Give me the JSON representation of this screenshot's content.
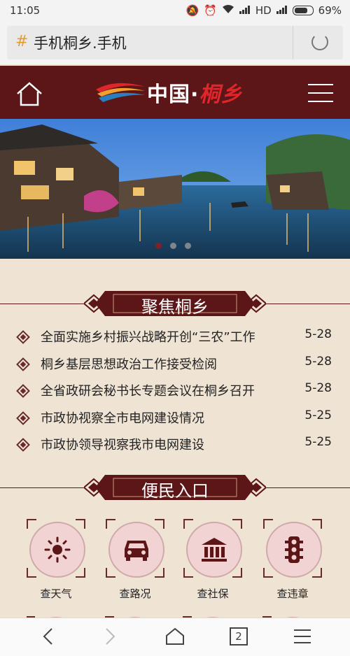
{
  "status_bar": {
    "time": "11:05",
    "network": "HD",
    "battery": "69%"
  },
  "url_bar": {
    "url_text": "手机桐乡.手机"
  },
  "header": {
    "logo_text_a": "中国·",
    "logo_text_b": "桐乡"
  },
  "banner": {
    "slide_count": 3,
    "active_slide": 0
  },
  "focus": {
    "title": "聚焦桐乡",
    "items": [
      {
        "title": "全面实施乡村振兴战略开创“三农”工作",
        "date": "5-28"
      },
      {
        "title": "桐乡基层思想政治工作接受检阅",
        "date": "5-28"
      },
      {
        "title": "全省政研会秘书长专题会议在桐乡召开",
        "date": "5-28"
      },
      {
        "title": "市政协视察全市电网建设情况",
        "date": "5-25"
      },
      {
        "title": "市政协领导视察我市电网建设",
        "date": "5-25"
      }
    ]
  },
  "services": {
    "title": "便民入口",
    "items": [
      {
        "label": "查天气",
        "icon": "sun-icon"
      },
      {
        "label": "查路况",
        "icon": "car-icon"
      },
      {
        "label": "查社保",
        "icon": "bank-icon"
      },
      {
        "label": "查违章",
        "icon": "traffic-light-icon"
      }
    ]
  },
  "bottom_nav": {
    "tabs_count": "2"
  },
  "colors": {
    "brand": "#5c1617",
    "accent": "#e0262a",
    "background": "#efe3d4"
  }
}
